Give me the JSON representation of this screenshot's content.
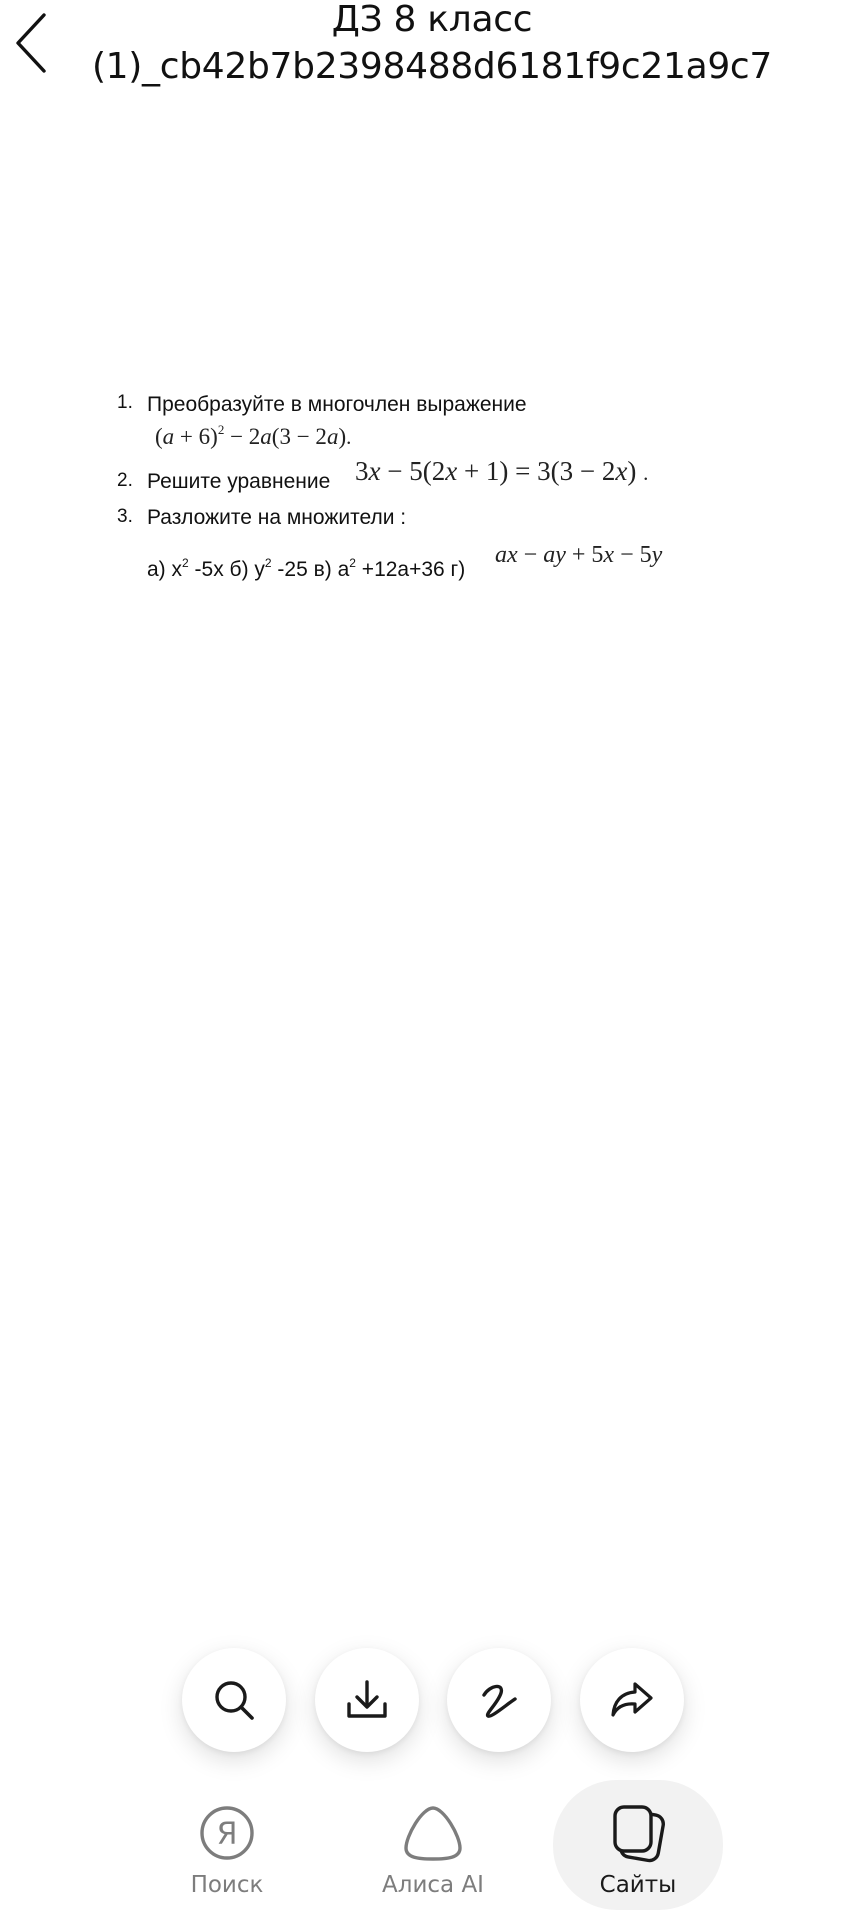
{
  "header": {
    "title_line1": "ДЗ 8 класс",
    "title_line2": "(1)_cb42b7b2398488d6181f9c21a9c7",
    "back_icon": "chevron-left-icon"
  },
  "document": {
    "item1": {
      "number": "1.",
      "text": "Преобразуйте в многочлен выражение"
    },
    "item2": {
      "number": "2.",
      "text": "Решите уравнение"
    },
    "item3": {
      "number": "3.",
      "text": "Разложите на множители :"
    },
    "parts": {
      "a_label": "а) х",
      "a_rest": " -5х б) у",
      "b_rest": " -25 в) а",
      "c_rest": " +12а+36 г)",
      "sup": "2"
    }
  },
  "actions": [
    {
      "name": "search",
      "icon": "search-icon"
    },
    {
      "name": "download",
      "icon": "download-icon"
    },
    {
      "name": "sign",
      "icon": "signature-icon"
    },
    {
      "name": "share",
      "icon": "share-icon"
    }
  ],
  "bottom_nav": {
    "tabs": [
      {
        "label": "Поиск",
        "icon": "yandex-icon",
        "active": false
      },
      {
        "label": "Алиса AI",
        "icon": "alice-icon",
        "active": false
      },
      {
        "label": "Сайты",
        "icon": "tabs-icon",
        "active": true
      }
    ]
  }
}
